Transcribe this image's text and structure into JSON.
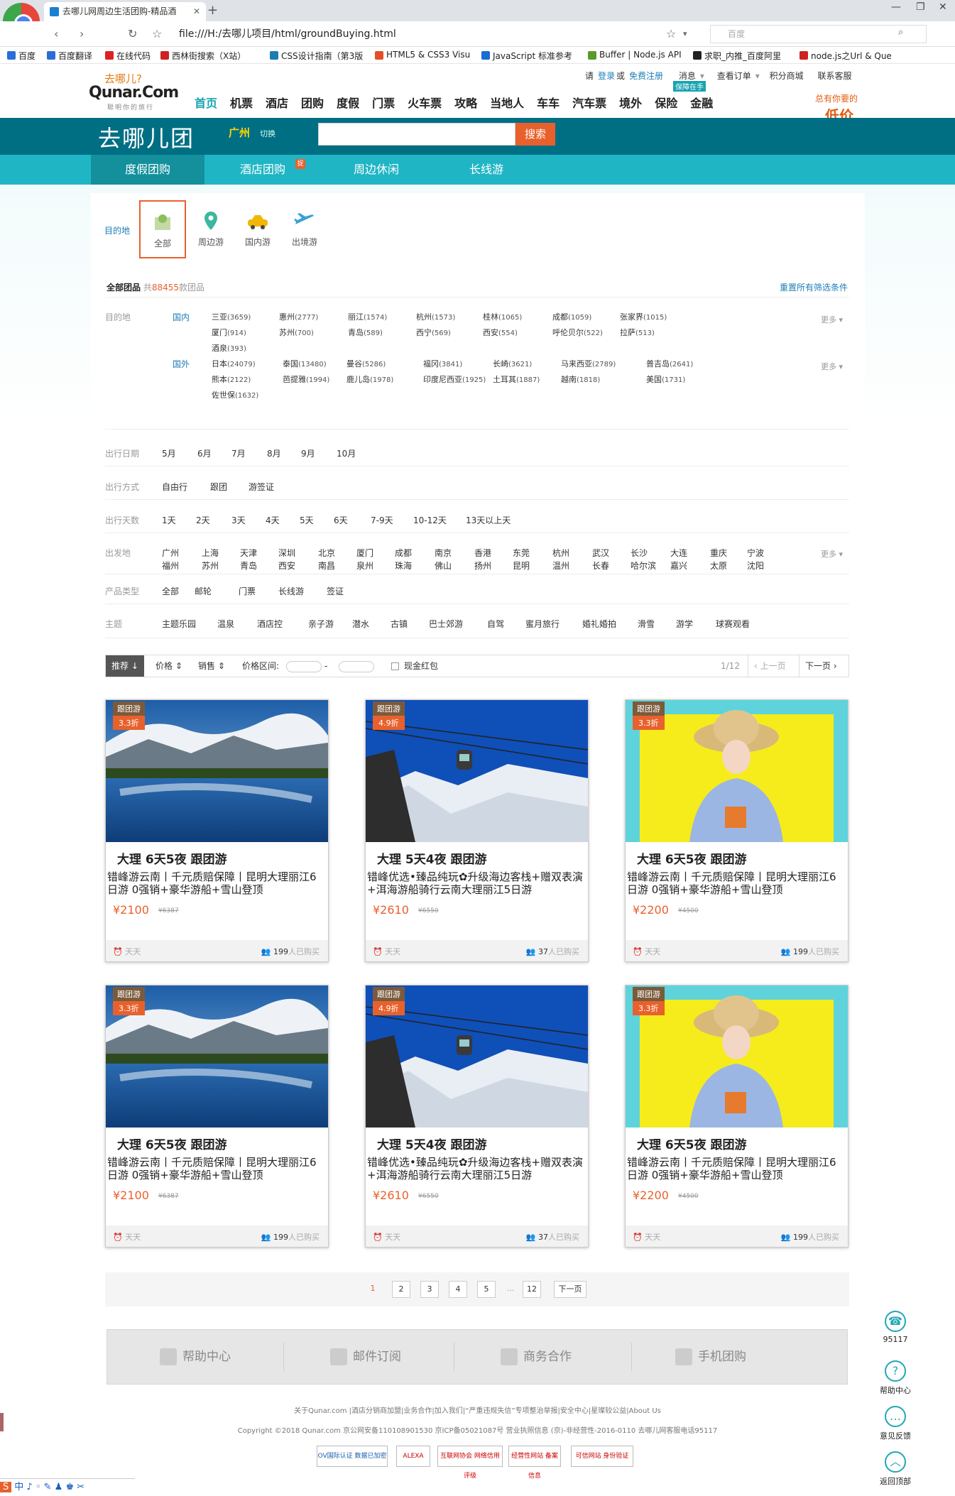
{
  "browser": {
    "tab_title": "去哪儿网周边生活团购-精品酒",
    "url": "file:///H:/去哪儿项目/html/groundBuying.html",
    "search_placeholder": "百度",
    "bookmarks": [
      "百度",
      "百度翻译",
      "在线代码",
      "西林街搜索（X站）",
      "CSS设计指南（第3版",
      "HTML5 & CSS3 Visu",
      "JavaScript 标准参考",
      "Buffer | Node.js API",
      "求职_内推_百度阿里",
      "node.js之Url & Que"
    ]
  },
  "header": {
    "logo_cn": "去哪儿?",
    "logo_en": "Qunar.Com",
    "logo_sub": "聪明你的旅行",
    "top_links": [
      "请",
      "登录",
      "或",
      "免费注册",
      "消息",
      "查看订单",
      "积分商城",
      "联系客服"
    ],
    "guarantee": "保障在手",
    "nav": [
      "首页",
      "机票",
      "酒店",
      "团购",
      "度假",
      "门票",
      "火车票",
      "攻略",
      "当地人",
      "车车",
      "汽车票",
      "境外",
      "保险",
      "金融"
    ],
    "ad_line1": "总有你要的",
    "ad_line2": "低价"
  },
  "band": {
    "title": "去哪儿团",
    "city": "广州",
    "switch": "切换",
    "search_btn": "搜索"
  },
  "subnav": {
    "items": [
      "度假团购",
      "酒店团购",
      "周边休闲",
      "长线游"
    ],
    "hot": "捉"
  },
  "filters": {
    "dest_label": "目的地",
    "dest_cats": [
      "全部",
      "周边游",
      "国内游",
      "出境游"
    ],
    "summary_prefix": "全部团品",
    "summary_mid": "共",
    "summary_count": "88455",
    "summary_suffix": "款团品",
    "reset": "重置所有筛选条件",
    "row_dest": "目的地",
    "domestic": "国内",
    "foreign": "国外",
    "more": "更多",
    "domestic_tags": [
      [
        "三亚",
        "(3659)"
      ],
      [
        "惠州",
        "(2777)"
      ],
      [
        "丽江",
        "(1574)"
      ],
      [
        "杭州",
        "(1573)"
      ],
      [
        "桂林",
        "(1065)"
      ],
      [
        "成都",
        "(1059)"
      ],
      [
        "张家界",
        "(1015)"
      ],
      [
        "厦门",
        "(914)"
      ],
      [
        "苏州",
        "(700)"
      ],
      [
        "青岛",
        "(589)"
      ],
      [
        "西宁",
        "(569)"
      ],
      [
        "西安",
        "(554)"
      ],
      [
        "呼伦贝尔",
        "(522)"
      ],
      [
        "拉萨",
        "(513)"
      ],
      [
        "酒泉",
        "(393)"
      ]
    ],
    "foreign_tags": [
      [
        "日本",
        "(24079)"
      ],
      [
        "泰国",
        "(13480)"
      ],
      [
        "曼谷",
        "(5286)"
      ],
      [
        "福冈",
        "(3841)"
      ],
      [
        "长崎",
        "(3621)"
      ],
      [
        "马来西亚",
        "(2789)"
      ],
      [
        "普吉岛",
        "(2641)"
      ],
      [
        "熊本",
        "(2122)"
      ],
      [
        "芭提雅",
        "(1994)"
      ],
      [
        "鹿儿岛",
        "(1978)"
      ],
      [
        "印度尼西亚",
        "(1925)"
      ],
      [
        "土耳其",
        "(1887)"
      ],
      [
        "越南",
        "(1818)"
      ],
      [
        "美国",
        "(1731)"
      ],
      [
        "佐世保",
        "(1632)"
      ]
    ],
    "date_label": "出行日期",
    "dates": [
      "5月",
      "6月",
      "7月",
      "8月",
      "9月",
      "10月"
    ],
    "mode_label": "出行方式",
    "modes": [
      "自由行",
      "跟团",
      "游签证"
    ],
    "days_label": "出行天数",
    "days": [
      "1天",
      "2天",
      "3天",
      "4天",
      "5天",
      "6天",
      "7-9天",
      "10-12天",
      "13天以上天"
    ],
    "from_label": "出发地",
    "from_top": [
      "广州",
      "上海",
      "天津",
      "深圳",
      "北京",
      "厦门",
      "成都",
      "南京",
      "香港",
      "东莞",
      "杭州",
      "武汉",
      "长沙",
      "大连",
      "重庆",
      "宁波"
    ],
    "from_bottom": [
      "福州",
      "苏州",
      "青岛",
      "西安",
      "南昌",
      "泉州",
      "珠海",
      "佛山",
      "扬州",
      "昆明",
      "温州",
      "长春",
      "哈尔滨",
      "嘉兴",
      "太原",
      "沈阳"
    ],
    "type_label": "产品类型",
    "types": [
      "全部",
      "邮轮",
      "门票",
      "长线游",
      "签证"
    ],
    "theme_label": "主题",
    "themes": [
      "主题乐园",
      "温泉",
      "酒店控",
      "亲子游",
      "潜水",
      "古镇",
      "巴士郊游",
      "自驾",
      "蜜月旅行",
      "婚礼婚拍",
      "滑雪",
      "游学",
      "球赛观看"
    ]
  },
  "sortbar": {
    "recommend": "推荐",
    "price": "价格",
    "sales": "销售",
    "range": "价格区间:",
    "dash": "-",
    "redpacket": "现金红包",
    "page": "1/12",
    "prev": "上一页",
    "next": "下一页"
  },
  "cards": [
    {
      "type": "跟团游",
      "discount": "3.3折",
      "title": "大理 6天5夜 跟团游",
      "desc": "错峰游云南丨千元质赔保障丨昆明大理丽江6日游 0强销+豪华游船+雪山登顶",
      "price": "¥2100",
      "old": "¥6387",
      "days": "天天",
      "sold": "199",
      "sold_suffix": "人已购买",
      "img": "lake"
    },
    {
      "type": "跟团游",
      "discount": "4.9折",
      "title": "大理 5天4夜 跟团游",
      "desc": "错峰优选•臻品纯玩✿升级海边客栈+赠双表演+洱海游船骑行云南大理丽江5日游",
      "price": "¥2610",
      "old": "¥6550",
      "days": "天天",
      "sold": "37",
      "sold_suffix": "人已购买",
      "img": "snow"
    },
    {
      "type": "跟团游",
      "discount": "3.3折",
      "title": "大理 6天5夜 跟团游",
      "desc": "错峰游云南丨千元质赔保障丨昆明大理丽江6日游 0强销+豪华游船+雪山登顶",
      "price": "¥2200",
      "old": "¥4500",
      "days": "天天",
      "sold": "199",
      "sold_suffix": "人已购买",
      "img": "girl"
    },
    {
      "type": "跟团游",
      "discount": "3.3折",
      "title": "大理 6天5夜 跟团游",
      "desc": "错峰游云南丨千元质赔保障丨昆明大理丽江6日游 0强销+豪华游船+雪山登顶",
      "price": "¥2100",
      "old": "¥6387",
      "days": "天天",
      "sold": "199",
      "sold_suffix": "人已购买",
      "img": "lake"
    },
    {
      "type": "跟团游",
      "discount": "4.9折",
      "title": "大理 5天4夜 跟团游",
      "desc": "错峰优选•臻品纯玩✿升级海边客栈+赠双表演+洱海游船骑行云南大理丽江5日游",
      "price": "¥2610",
      "old": "¥6550",
      "days": "天天",
      "sold": "37",
      "sold_suffix": "人已购买",
      "img": "snow"
    },
    {
      "type": "跟团游",
      "discount": "3.3折",
      "title": "大理 6天5夜 跟团游",
      "desc": "错峰游云南丨千元质赔保障丨昆明大理丽江6日游 0强销+豪华游船+雪山登顶",
      "price": "¥2200",
      "old": "¥4500",
      "days": "天天",
      "sold": "199",
      "sold_suffix": "人已购买",
      "img": "girl"
    }
  ],
  "pager": {
    "pages": [
      "1",
      "2",
      "3",
      "4",
      "5"
    ],
    "ellipsis": "...",
    "last": "12",
    "next": "下一页"
  },
  "footer": {
    "boxes": [
      "帮助中心",
      "邮件订阅",
      "商务合作",
      "手机团购"
    ],
    "links1": "关于Qunar.com    |酒店分销商加盟|业务合作|加入我们|“严重违规失信”专项整治举报|安全中心|星璨较公益|About Us",
    "links2": "Copyright ©2018 Qunar.com 京公网安备110108901530 京ICP备05021087号 营业执照信息 (京)-非经营性-2016-0110    去哪儿网客服电话95117",
    "certs": [
      "OV国际认证 数据已加密",
      "ALEXA",
      "互联网协会 网络信用评级",
      "经营性网站 备案信息",
      "可信网站 身份验证"
    ]
  },
  "side": {
    "phone": "95117",
    "help": "帮助中心",
    "feedback": "意见反馈",
    "top": "返回顶部"
  },
  "taskbar": "中 ♪ ◦ ✎ ♟ ♚ ✂"
}
